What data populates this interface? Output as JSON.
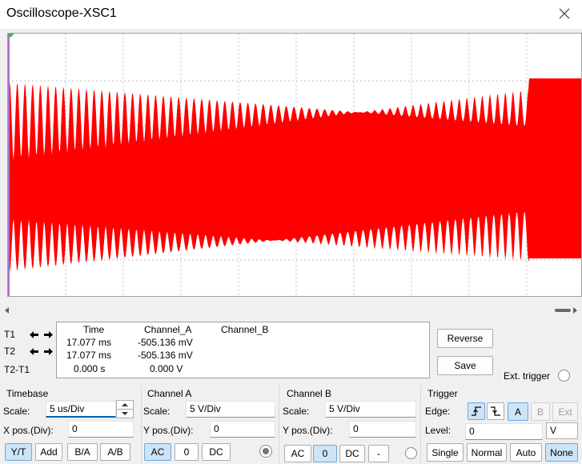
{
  "window": {
    "title": "Oscilloscope-XSC1"
  },
  "readout": {
    "headers": {
      "time": "Time",
      "channel_a": "Channel_A",
      "channel_b": "Channel_B"
    },
    "t1": {
      "label": "T1",
      "time": "17.077 ms",
      "channel_a": "-505.136 mV"
    },
    "t2": {
      "label": "T2",
      "time": "17.077 ms",
      "channel_a": "-505.136 mV"
    },
    "t2_t1": {
      "label": "T2-T1",
      "time": "0.000 s",
      "channel_a": "0.000 V"
    }
  },
  "actions": {
    "reverse": "Reverse",
    "save": "Save",
    "ext_trigger": "Ext. trigger"
  },
  "timebase": {
    "title": "Timebase",
    "scale_label": "Scale:",
    "scale_value": "5 us/Div",
    "xpos_label": "X pos.(Div):",
    "xpos_value": "0",
    "modes": [
      "Y/T",
      "Add",
      "B/A",
      "A/B"
    ]
  },
  "channel_a": {
    "title": "Channel A",
    "scale_label": "Scale:",
    "scale_value": "5  V/Div",
    "ypos_label": "Y pos.(Div):",
    "ypos_value": "0",
    "coupling": [
      "AC",
      "0",
      "DC"
    ]
  },
  "channel_b": {
    "title": "Channel B",
    "scale_label": "Scale:",
    "scale_value": "5  V/Div",
    "ypos_label": "Y pos.(Div):",
    "ypos_value": "0",
    "coupling": [
      "AC",
      "0",
      "DC",
      "-"
    ]
  },
  "trigger": {
    "title": "Trigger",
    "edge_label": "Edge:",
    "sources": [
      "A",
      "B",
      "Ext"
    ],
    "level_label": "Level:",
    "level_value": "0",
    "level_unit": "V",
    "modes": [
      "Single",
      "Normal",
      "Auto",
      "None"
    ]
  },
  "display": {
    "trace_color": "#ff0000",
    "background": "#ffffff",
    "grid_color": "#c0c0c0"
  }
}
